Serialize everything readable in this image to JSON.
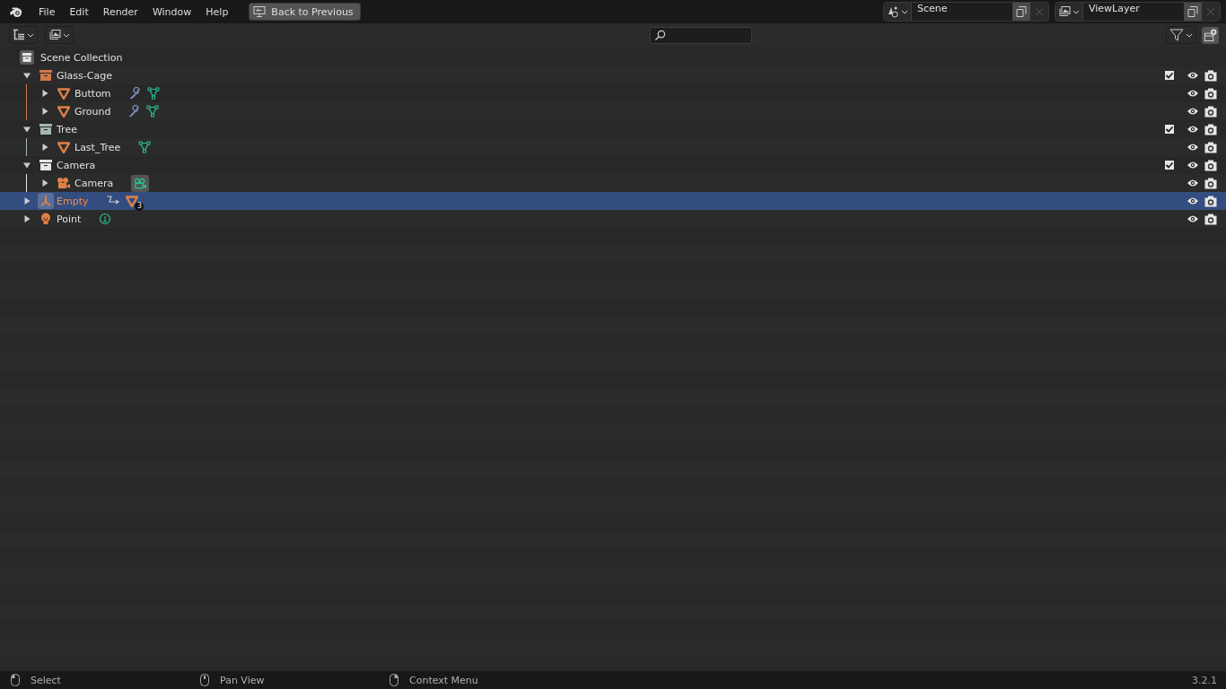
{
  "menu": [
    "File",
    "Edit",
    "Render",
    "Window",
    "Help"
  ],
  "back_button": "Back to Previous",
  "scene": {
    "value": "Scene"
  },
  "view_layer": {
    "value": "ViewLayer"
  },
  "tree": {
    "label": "Scene Collection",
    "children": [
      {
        "kind": "collection",
        "name": "Glass-Cage",
        "color": "#d0784a",
        "expanded": true,
        "checked": true,
        "selected": false,
        "active": false,
        "children": [
          {
            "kind": "mesh",
            "name": "Buttom",
            "expanded": false,
            "selected": false,
            "active": false,
            "extras": [
              {
                "kind": "modifier"
              },
              {
                "kind": "mesh_data"
              }
            ]
          },
          {
            "kind": "mesh",
            "name": "Ground",
            "expanded": false,
            "selected": false,
            "active": false,
            "extras": [
              {
                "kind": "modifier"
              },
              {
                "kind": "mesh_data"
              }
            ]
          }
        ]
      },
      {
        "kind": "collection",
        "name": "Tree",
        "color": "#a3b8ac",
        "expanded": true,
        "checked": true,
        "selected": false,
        "active": false,
        "children": [
          {
            "kind": "mesh",
            "name": "Last_Tree",
            "expanded": false,
            "selected": false,
            "active": false,
            "extras": [
              {
                "kind": "mesh_data"
              }
            ]
          }
        ]
      },
      {
        "kind": "collection",
        "name": "Camera",
        "color": "#e6e6e6",
        "expanded": true,
        "checked": true,
        "selected": false,
        "active": false,
        "children": [
          {
            "kind": "camera",
            "name": "Camera",
            "expanded": false,
            "selected": false,
            "active": false,
            "extras": [
              {
                "kind": "camera_data"
              }
            ]
          }
        ]
      },
      {
        "kind": "empty",
        "name": "Empty",
        "expanded": false,
        "selected": true,
        "active": true,
        "extras": [
          {
            "kind": "constraint"
          },
          {
            "kind": "mesh_object",
            "badge": "3"
          }
        ]
      },
      {
        "kind": "light",
        "name": "Point",
        "expanded": false,
        "selected": false,
        "active": false,
        "extras": [
          {
            "kind": "light_data"
          }
        ]
      }
    ]
  },
  "status_bar": [
    {
      "kind": "left",
      "label": "Select"
    },
    {
      "kind": "middle",
      "label": "Pan View"
    },
    {
      "kind": "right",
      "label": "Context Menu"
    }
  ],
  "version": "3.2.1"
}
